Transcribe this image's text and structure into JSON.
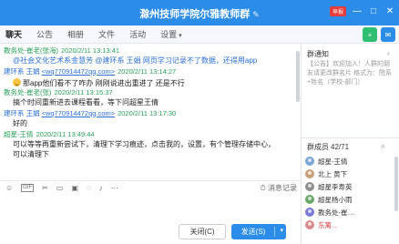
{
  "window": {
    "title": "滁州技师学院尔雅教师群",
    "edit_icon": "pencil-icon",
    "badge_text": "早报",
    "minimize": "—",
    "maximize": "□",
    "close": "✕"
  },
  "tabs": [
    {
      "label": "聊天",
      "active": true
    },
    {
      "label": "公告",
      "active": false
    },
    {
      "label": "相册",
      "active": false
    },
    {
      "label": "文件",
      "active": false
    },
    {
      "label": "活动",
      "active": false
    },
    {
      "label": "设置",
      "active": false
    }
  ],
  "settings_caret": "▾",
  "messages": [
    {
      "name": "教务处-崔老(张海)",
      "email": "",
      "time": "2020/2/11 13:13:41",
      "text": "@社会文化艺术系金慧芳 @建环系 王娟  网页学习记录不了数据，还得用app"
    },
    {
      "name": "建环系 王娟",
      "email": "<wq770914472qq.com>",
      "time": "2020/2/11 13:14:27",
      "text": ""
    },
    {
      "name": "教务处-崔老(张)",
      "email": "",
      "time": "2020/2/11 13:15:37",
      "text": "那app他们看不了咋办 刚刚说进出重进了 还是不行"
    },
    {
      "name": "",
      "email": "",
      "time": "",
      "text": "搞个时间重新进去课程看看，等下问超星王倩"
    },
    {
      "name": "建环系 王娟",
      "email": "<wq770914472qq.com>",
      "time": "2020/2/11 13:17:30",
      "text": "好的"
    },
    {
      "name": "超星-王倩",
      "email": "",
      "time": "2020/2/11 13:49:44",
      "text": "可以等等再重新尝试下，清理下学习痕迹，点击我的，设置，有个管理存储中心，可以清理下"
    }
  ],
  "toolbar": {
    "history_label": "消息记录",
    "tools": [
      "smile-icon",
      "gif-icon",
      "scissors-icon",
      "folder-icon",
      "image-icon",
      "shake-icon",
      "mic-icon",
      "more-icon"
    ]
  },
  "buttons": {
    "close_label": "关闭(C)",
    "send_label": "发送(S)",
    "send_arrow": "▾"
  },
  "sidebar": {
    "notice_title": "群通知",
    "notice_text": "【公告】欢迎加入！人群的朋友请更改群名片 格式为：院系+姓名（学校-部门）",
    "members_title": "群成员",
    "members_count": "42/71",
    "members": [
      {
        "name": "超星-王倩",
        "color": "normal"
      },
      {
        "name": "北上 黄下",
        "color": "normal"
      },
      {
        "name": "超星李寿英",
        "color": "normal"
      },
      {
        "name": "超星杨小雨",
        "color": "normal"
      },
      {
        "name": "教务处-崔…",
        "color": "normal"
      },
      {
        "name": "东篱...",
        "color": "red"
      }
    ]
  }
}
